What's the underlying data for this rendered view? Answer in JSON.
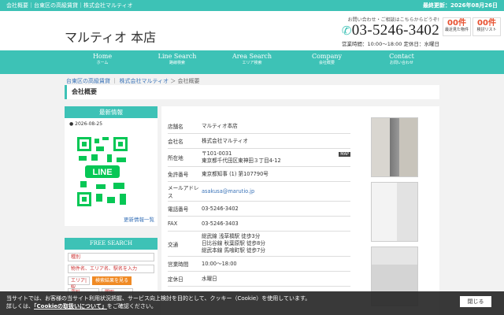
{
  "topbar": {
    "breadcrumb": "会社概要｜台東区の高級賃貸｜株式会社マルティオ",
    "updated": "最終更新：2026年08月26日"
  },
  "header": {
    "logo": "マルティオ 本店",
    "contact_note": "お問い合わせ・ご相談はこちらからどうぞ!",
    "tel": "03-5246-3402",
    "hours": "営業時間：10:00〜18:00 定休日：水曜日",
    "counters": [
      {
        "count": "00件",
        "label": "最近見た物件"
      },
      {
        "count": "00件",
        "label": "検討リスト"
      }
    ]
  },
  "nav": [
    {
      "en": "Home",
      "jp": "ホーム"
    },
    {
      "en": "Line Search",
      "jp": "路線検索"
    },
    {
      "en": "Area Search",
      "jp": "エリア検索"
    },
    {
      "en": "Company",
      "jp": "会社概要"
    },
    {
      "en": "Contact",
      "jp": "お問い合わせ"
    }
  ],
  "breadcrumb": {
    "link1": "台東区の高級賃貸",
    "link2": "株式会社マルティオ",
    "current": "会社概要"
  },
  "page_title": "会社概要",
  "sidebar": {
    "news_title": "最新情報",
    "news_date": "2026-08-25",
    "news_more": "更新情報一覧",
    "search_title": "FREE SEARCH",
    "search_type": "種別",
    "search_placeholder": "物件名、エリア名、駅名を入力",
    "search_area": "エリア|駅",
    "search_rent": "賃料",
    "search_layout": "間取",
    "search_button": "検索結果を見る"
  },
  "info": [
    {
      "k": "店舗名",
      "v": "マルティオ本店"
    },
    {
      "k": "会社名",
      "v": "株式会社マルティオ"
    },
    {
      "k": "所在地",
      "v": "〒101-0031\n東京都千代田区東神田３丁目4-12",
      "tag": "MAP"
    },
    {
      "k": "免許番号",
      "v": "東京都知事 (1) 第107790号"
    },
    {
      "k": "メールアドレス",
      "v": "asakusa@marutio.jp",
      "link": true
    },
    {
      "k": "電話番号",
      "v": "03-5246-3402"
    },
    {
      "k": "FAX",
      "v": "03-5246-3403"
    },
    {
      "k": "交通",
      "v": "総武線 浅草橋駅 徒歩3分\n日比谷線 秋葉原駅 徒歩8分\n総武本線 馬喰町駅 徒歩7分"
    },
    {
      "k": "営業時間",
      "v": "10:00〜18:00"
    },
    {
      "k": "定休日",
      "v": "水曜日"
    }
  ],
  "cookie": {
    "line1": "当サイトでは、お客様の当サイト利用状況把握、サービス向上検討を目的として、クッキー（Cookie）を使用しています。",
    "line2a": "詳しくは、",
    "line2link": "「Cookieの取扱いについて」",
    "line2b": "をご確認ください。",
    "close": "閉じる"
  }
}
